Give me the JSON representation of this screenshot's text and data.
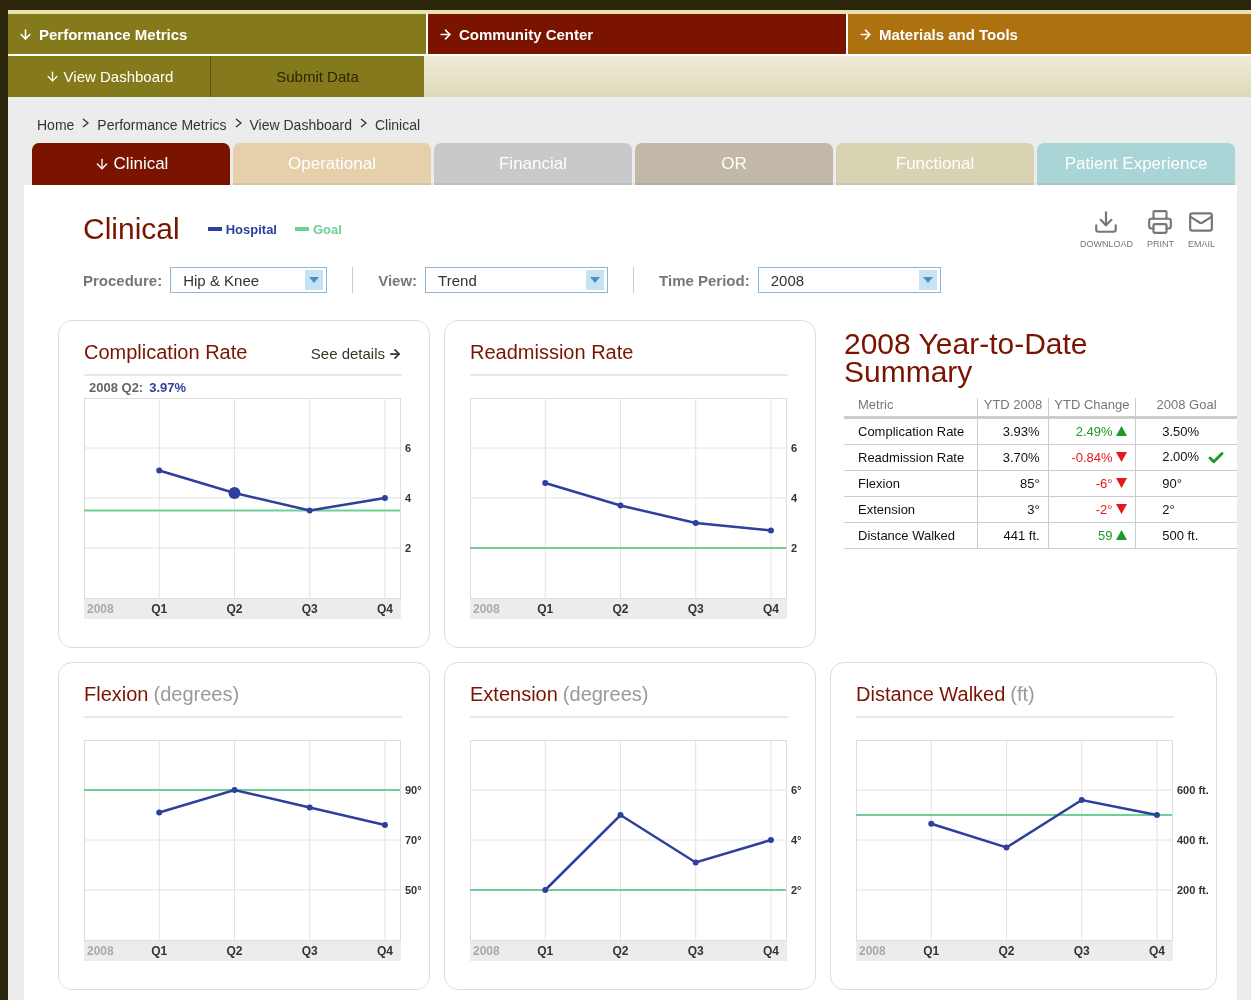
{
  "top_nav": [
    {
      "label": "Performance Metrics",
      "expanded": true,
      "color": "#857a1b"
    },
    {
      "label": "Community Center",
      "expanded": false,
      "color": "#7a1400"
    },
    {
      "label": "Materials and Tools",
      "expanded": false,
      "color": "#ad720f"
    }
  ],
  "sub_nav": [
    {
      "label": "View Dashboard",
      "selected": true
    },
    {
      "label": "Submit Data",
      "selected": false
    }
  ],
  "breadcrumb": [
    "Home",
    "Performance Metrics",
    "View Dashboard",
    "Clinical"
  ],
  "tabs": [
    {
      "label": "Clinical",
      "selected": true,
      "color": "#7a1400"
    },
    {
      "label": "Operational",
      "selected": false,
      "color": "#e5cfa8"
    },
    {
      "label": "Financial",
      "selected": false,
      "color": "#c8c8ca"
    },
    {
      "label": "OR",
      "selected": false,
      "color": "#bfb6a4"
    },
    {
      "label": "Functional",
      "selected": false,
      "color": "#d7d2b0"
    },
    {
      "label": "Patient Experience",
      "selected": false,
      "color": "#a6d4d6"
    }
  ],
  "page_title": "Clinical",
  "legend": [
    {
      "label": "Hospital",
      "color": "#2e3f9c"
    },
    {
      "label": "Goal",
      "color": "#6fcf97"
    }
  ],
  "actions": [
    {
      "kind": "download",
      "label": "DOWNLOAD"
    },
    {
      "kind": "print",
      "label": "PRINT"
    },
    {
      "kind": "email",
      "label": "EMAIL"
    }
  ],
  "filters": [
    {
      "label": "Procedure:",
      "value": "Hip & Knee"
    },
    {
      "label": "View:",
      "value": "Trend"
    },
    {
      "label": "Time Period:",
      "value": "2008"
    }
  ],
  "charts": [
    {
      "title": "Complication Rate",
      "link": "See details",
      "readout": {
        "label": "2008 Q2:",
        "value": "3.97%"
      },
      "chart_data": {
        "type": "line",
        "grid": true,
        "xlabel": "2008",
        "categories": [
          "Q1",
          "Q2",
          "Q3",
          "Q4"
        ],
        "ylim": [
          0,
          8
        ],
        "yticks": [
          2,
          4,
          6
        ],
        "annotations": [
          {
            "x": "Q2"
          }
        ],
        "ref_lines": [
          {
            "axis": "y",
            "value": 3.5,
            "color": "#6fcf97"
          }
        ],
        "series": [
          {
            "color": "#2e3f9c",
            "marker": true,
            "values": [
              5.1,
              4.2,
              3.5,
              4.0
            ]
          }
        ]
      }
    },
    {
      "title": "Readmission Rate",
      "chart_data": {
        "type": "line",
        "grid": true,
        "xlabel": "2008",
        "categories": [
          "Q1",
          "Q2",
          "Q3",
          "Q4"
        ],
        "ylim": [
          0,
          8
        ],
        "yticks": [
          2,
          4,
          6
        ],
        "ref_lines": [
          {
            "axis": "y",
            "value": 2,
            "color": "#6fcf97"
          }
        ],
        "series": [
          {
            "color": "#2e3f9c",
            "marker": true,
            "values": [
              4.6,
              3.7,
              3.0,
              2.7
            ]
          }
        ]
      }
    },
    {
      "title": "Flexion",
      "unit": "(degrees)",
      "chart_data": {
        "type": "line",
        "grid": true,
        "xlabel": "2008",
        "categories": [
          "Q1",
          "Q2",
          "Q3",
          "Q4"
        ],
        "ylim": [
          30,
          110
        ],
        "yticks": [
          {
            "value": 50,
            "label": "50°"
          },
          {
            "value": 70,
            "label": "70°"
          },
          {
            "value": 90,
            "label": "90°"
          }
        ],
        "ref_lines": [
          {
            "axis": "y",
            "value": 90,
            "color": "#6fcf97"
          }
        ],
        "series": [
          {
            "color": "#2e3f9c",
            "marker": true,
            "values": [
              81,
              90,
              83,
              76
            ]
          }
        ]
      }
    },
    {
      "title": "Extension",
      "unit": "(degrees)",
      "chart_data": {
        "type": "line",
        "grid": true,
        "xlabel": "2008",
        "categories": [
          "Q1",
          "Q2",
          "Q3",
          "Q4"
        ],
        "ylim": [
          0,
          8
        ],
        "yticks": [
          {
            "value": 2,
            "label": "2°"
          },
          {
            "value": 4,
            "label": "4°"
          },
          {
            "value": 6,
            "label": "6°"
          }
        ],
        "ref_lines": [
          {
            "axis": "y",
            "value": 2,
            "color": "#6fcf97"
          }
        ],
        "series": [
          {
            "color": "#2e3f9c",
            "marker": true,
            "values": [
              2,
              5,
              3.1,
              4
            ]
          }
        ]
      }
    },
    {
      "title": "Distance Walked",
      "unit": "(ft)",
      "chart_data": {
        "type": "line",
        "grid": true,
        "xlabel": "2008",
        "categories": [
          "Q1",
          "Q2",
          "Q3",
          "Q4"
        ],
        "ylim": [
          0,
          800
        ],
        "yticks": [
          {
            "value": 200,
            "label": "200 ft."
          },
          {
            "value": 400,
            "label": "400 ft."
          },
          {
            "value": 600,
            "label": "600 ft."
          }
        ],
        "ref_lines": [
          {
            "axis": "y",
            "value": 500,
            "color": "#6fcf97"
          }
        ],
        "series": [
          {
            "color": "#2e3f9c",
            "marker": true,
            "values": [
              465,
              370,
              560,
              500
            ]
          }
        ]
      }
    }
  ],
  "summary": {
    "title": "2008 Year-to-Date Summary",
    "columns": [
      "Metric",
      "YTD 2008",
      "YTD Change",
      "2008 Goal"
    ],
    "rows": [
      {
        "metric": "Complication Rate",
        "ytd": "3.93%",
        "change": "2.49%",
        "increase": true,
        "goal": "3.50%",
        "goal_met": false
      },
      {
        "metric": "Readmission Rate",
        "ytd": "3.70%",
        "change": "-0.84%",
        "increase": false,
        "goal": "2.00%",
        "goal_met": true
      },
      {
        "metric": "Flexion",
        "ytd": "85°",
        "change": "-6°",
        "increase": false,
        "goal": "90°",
        "goal_met": false
      },
      {
        "metric": "Extension",
        "ytd": "3°",
        "change": "-2°",
        "increase": false,
        "goal": "2°",
        "goal_met": false
      },
      {
        "metric": "Distance Walked",
        "ytd": "441 ft.",
        "change": "59",
        "increase": true,
        "goal": "500 ft.",
        "goal_met": false
      }
    ]
  }
}
